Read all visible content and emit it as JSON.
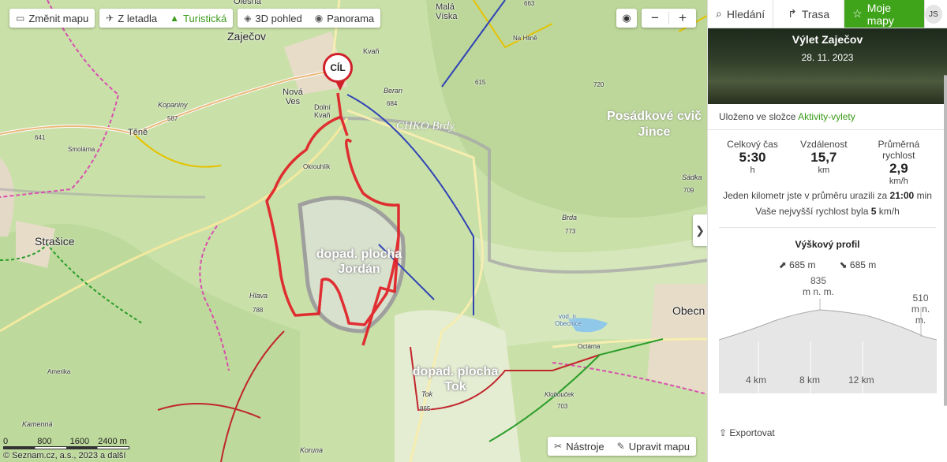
{
  "toolbar": {
    "change_map": "Změnit mapu",
    "aerial": "Z letadla",
    "tourist": "Turistická",
    "view3d": "3D pohled",
    "panorama": "Panorama"
  },
  "map_labels": {
    "zajecov": "Zaječov",
    "mala_viska": "Malá Víska",
    "olesna": "Olešná",
    "nova_ves": "Nová Ves",
    "kvan": "Kvaň",
    "dolni_kvan": "Dolní Kvaň",
    "tene": "Těně",
    "strasice": "Strašice",
    "kopaniny": "Kopaniny",
    "hlava": "Hlava",
    "beran": "Beran",
    "brda": "Brda",
    "sadka": "Sádka",
    "obecnice": "Obecn",
    "jince": "Posádkové cvič Jince",
    "okrouhlik": "Okrouhlík",
    "smolarna": "Smolárna",
    "amerika": "Amerika",
    "kamenna": "Kamenná",
    "koruna": "Koruna",
    "tok": "Tok",
    "klobouček": "Klobouček",
    "octarna": "Octárna",
    "na_hlinach": "Na Hlině",
    "vod_n_obecnice": "vod. n. Obecnice",
    "chko": "CHKO Brdy",
    "area_jordan": "dopad. plocha Jordán",
    "area_tok": "dopad. plocha Tok",
    "heights": [
      "641",
      "587",
      "788",
      "684",
      "615",
      "720",
      "773",
      "709",
      "865",
      "703",
      "663"
    ]
  },
  "marker": {
    "label": "CÍL"
  },
  "map_controls": {
    "zoom_in": "+",
    "zoom_out": "−",
    "tools": "Nástroje",
    "edit_map": "Upravit mapu",
    "scale": [
      "0",
      "800",
      "1600",
      "2400 m"
    ],
    "copyright": "© Seznam.cz, a.s., 2023 a další"
  },
  "panel": {
    "tabs": [
      "Hledání",
      "Trasa",
      "Moje mapy"
    ],
    "user_initials": "JS",
    "trip_title": "Výlet Zaječov",
    "trip_date": "28. 11. 2023",
    "saved_prefix": "Uloženo ve složce",
    "saved_folder": "Aktivity-vylety",
    "stats": [
      {
        "label": "Celkový čas",
        "value": "5:30",
        "unit": "h"
      },
      {
        "label": "Vzdálenost",
        "value": "15,7",
        "unit": "km"
      },
      {
        "label": "Průměrná rychlost",
        "value": "2,9",
        "unit": "km/h"
      }
    ],
    "pace_text": "Jeden kilometr jste v průměru urazili za",
    "pace_value": "21:00",
    "pace_unit": "min",
    "max_speed_text": "Vaše nejvyšší rychlost byla",
    "max_speed_value": "5",
    "max_speed_unit": "km/h",
    "profile_title": "Výškový profil",
    "ascent": "685 m",
    "descent": "685 m",
    "max_elev": "835",
    "min_elev": "510",
    "elev_unit": "m n. m.",
    "km_ticks": [
      "4 km",
      "8 km",
      "12 km"
    ],
    "export": "Exportovat"
  }
}
